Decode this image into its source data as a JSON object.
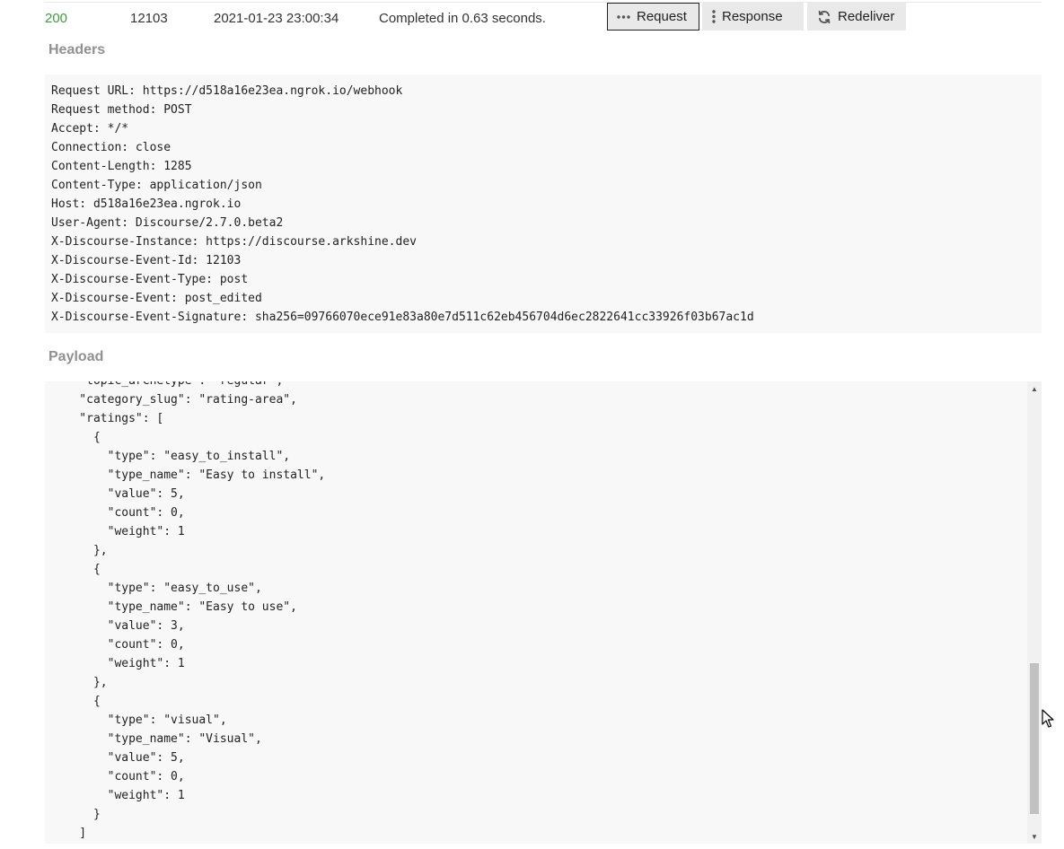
{
  "delivery": {
    "status": "200",
    "event_id": "12103",
    "datetime": "2021-01-23 23:00:34",
    "message": "Completed in 0.63 seconds."
  },
  "buttons": {
    "request_label": "Request",
    "response_label": "Response",
    "redeliver_label": "Redeliver",
    "active_tab": "Request",
    "request_icon": "ellipsis-horizontal-icon",
    "response_icon": "ellipsis-vertical-icon",
    "redeliver_icon": "sync-arrows-icon"
  },
  "sections": {
    "headers_title": "Headers",
    "payload_title": "Payload"
  },
  "headers": [
    "Request URL: https://d518a16e23ea.ngrok.io/webhook",
    "Request method: POST",
    "Accept: */*",
    "Connection: close",
    "Content-Length: 1285",
    "Content-Type: application/json",
    "Host: d518a16e23ea.ngrok.io",
    "User-Agent: Discourse/2.7.0.beta2",
    "X-Discourse-Instance: https://discourse.arkshine.dev",
    "X-Discourse-Event-Id: 12103",
    "X-Discourse-Event-Type: post",
    "X-Discourse-Event: post_edited",
    "X-Discourse-Event-Signature: sha256=09766070ece91e83a80e7d511c62eb456704d6ec2822641cc33926f03b67ac1d"
  ],
  "payload": [
    "    \"topic_archetype\": \"regular\",",
    "    \"category_slug\": \"rating-area\",",
    "    \"ratings\": [",
    "      {",
    "        \"type\": \"easy_to_install\",",
    "        \"type_name\": \"Easy to install\",",
    "        \"value\": 5,",
    "        \"count\": 0,",
    "        \"weight\": 1",
    "      },",
    "      {",
    "        \"type\": \"easy_to_use\",",
    "        \"type_name\": \"Easy to use\",",
    "        \"value\": 3,",
    "        \"count\": 0,",
    "        \"weight\": 1",
    "      },",
    "      {",
    "        \"type\": \"visual\",",
    "        \"type_name\": \"Visual\",",
    "        \"value\": 5,",
    "        \"count\": 0,",
    "        \"weight\": 1",
    "      }",
    "    ]",
    "  }"
  ],
  "colors": {
    "status_success": "#3d9a3d",
    "section_title": "#919191",
    "code_background": "#f8f8f8",
    "button_background": "#e9e9e9"
  }
}
